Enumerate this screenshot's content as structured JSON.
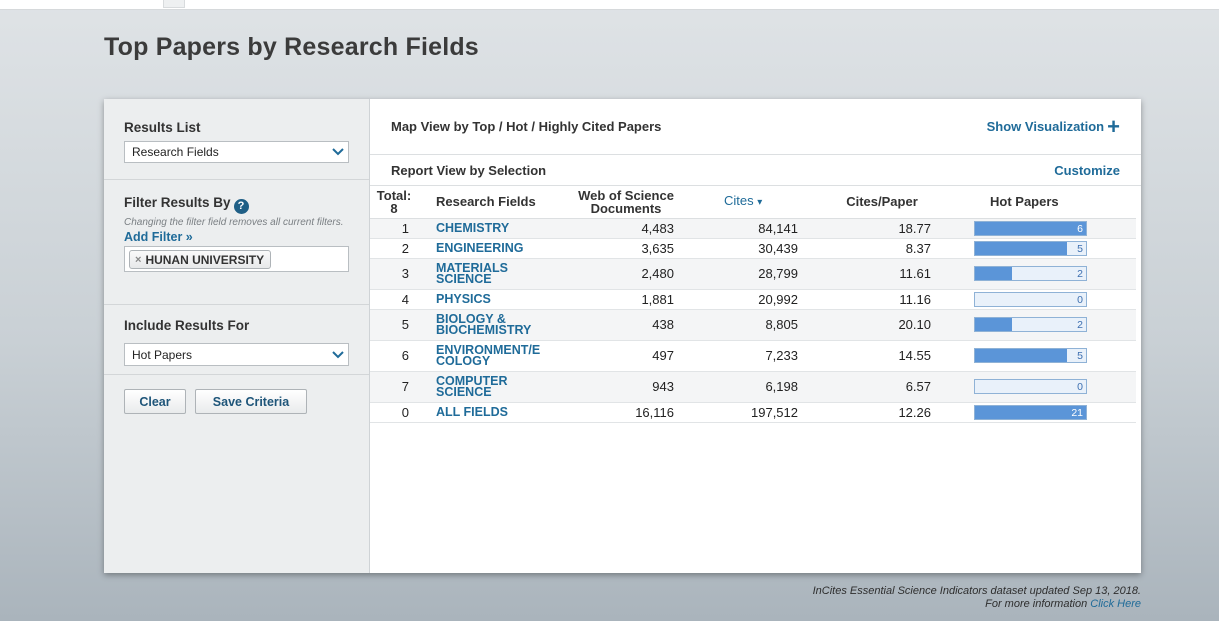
{
  "page": {
    "title": "Top Papers by Research Fields"
  },
  "sidebar": {
    "results_list_label": "Results List",
    "results_list_value": "Research Fields",
    "filter_heading": "Filter Results By",
    "filter_help_icon": "?",
    "filter_note": "Changing the filter field removes all current filters.",
    "add_filter": "Add Filter »",
    "filter_chip": "HUNAN UNIVERSITY",
    "filter_chip_remove": "×",
    "include_label": "Include Results For",
    "include_value": "Hot Papers",
    "clear_label": "Clear",
    "save_label": "Save Criteria"
  },
  "main": {
    "map_view_label": "Map View by Top / Hot / Highly Cited Papers",
    "show_visualization": "Show Visualization",
    "report_view_label": "Report View by Selection",
    "customize": "Customize",
    "columns": {
      "total": "Total:",
      "total_count": "8",
      "field": "Research Fields",
      "docs_line1": "Web of Science",
      "docs_line2": "Documents",
      "cites": "Cites",
      "cites_sort_icon": "▾",
      "cites_paper": "Cites/Paper",
      "hot_papers": "Hot Papers"
    },
    "rows": [
      {
        "rank": "1",
        "field_line1": "CHEMISTRY",
        "field_line2": "",
        "docs": "4,483",
        "cites": "84,141",
        "cites_paper": "18.77",
        "hot": "6",
        "hot_frac": 1.0
      },
      {
        "rank": "2",
        "field_line1": "ENGINEERING",
        "field_line2": "",
        "docs": "3,635",
        "cites": "30,439",
        "cites_paper": "8.37",
        "hot": "5",
        "hot_frac": 0.833
      },
      {
        "rank": "3",
        "field_line1": "MATERIALS",
        "field_line2": "SCIENCE",
        "docs": "2,480",
        "cites": "28,799",
        "cites_paper": "11.61",
        "hot": "2",
        "hot_frac": 0.333
      },
      {
        "rank": "4",
        "field_line1": "PHYSICS",
        "field_line2": "",
        "docs": "1,881",
        "cites": "20,992",
        "cites_paper": "11.16",
        "hot": "0",
        "hot_frac": 0.0
      },
      {
        "rank": "5",
        "field_line1": "BIOLOGY &",
        "field_line2": "BIOCHEMISTRY",
        "docs": "438",
        "cites": "8,805",
        "cites_paper": "20.10",
        "hot": "2",
        "hot_frac": 0.333
      },
      {
        "rank": "6",
        "field_line1": "ENVIRONMENT/E",
        "field_line2": "COLOGY",
        "docs": "497",
        "cites": "7,233",
        "cites_paper": "14.55",
        "hot": "5",
        "hot_frac": 0.833
      },
      {
        "rank": "7",
        "field_line1": "COMPUTER",
        "field_line2": "SCIENCE",
        "docs": "943",
        "cites": "6,198",
        "cites_paper": "6.57",
        "hot": "0",
        "hot_frac": 0.0
      },
      {
        "rank": "0",
        "field_line1": "ALL FIELDS",
        "field_line2": "",
        "docs": "16,116",
        "cites": "197,512",
        "cites_paper": "12.26",
        "hot": "21",
        "hot_frac": 1.0
      }
    ]
  },
  "footer": {
    "line1": "InCites Essential Science Indicators dataset updated Sep 13, 2018.",
    "line2_prefix": "For more information",
    "line2_link": "Click Here"
  },
  "colors": {
    "link": "#1f6b99",
    "bar_fill": "#5b95d8",
    "bar_bg": "#e9f1fa"
  }
}
